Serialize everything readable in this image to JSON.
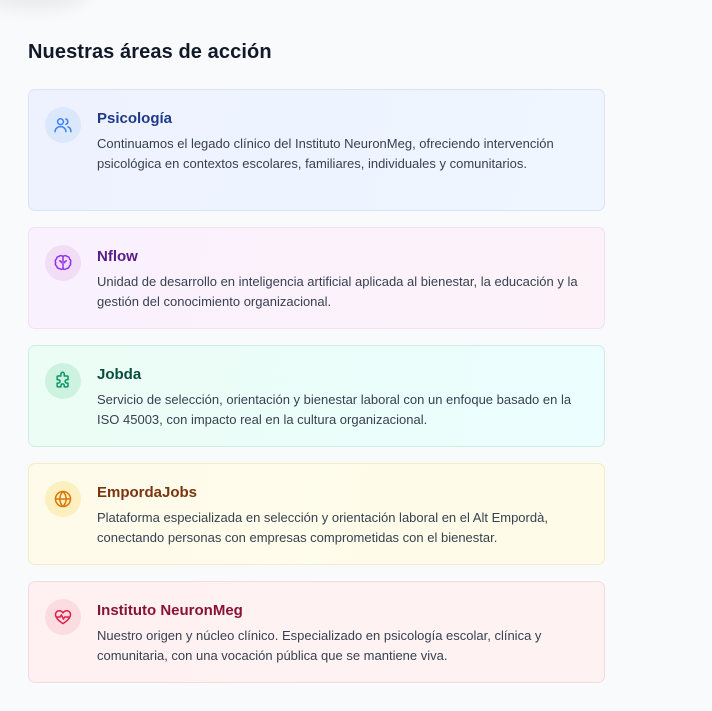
{
  "section": {
    "title": "Nuestras áreas de acción"
  },
  "cards": [
    {
      "title": "Psicología",
      "description": "Continuamos el legado clínico del Instituto NeuronMeg, ofreciendo intervención psicológica en contextos escolares, familiares, individuales y comunitarios.",
      "icon": "users-icon",
      "accent": "#1e3a8a"
    },
    {
      "title": "Nflow",
      "description": "Unidad de desarrollo en inteligencia artificial aplicada al bienestar, la educación y la gestión del conocimiento organizacional.",
      "icon": "brain-icon",
      "accent": "#581c87"
    },
    {
      "title": "Jobda",
      "description": "Servicio de selección, orientación y bienestar laboral con un enfoque basado en la ISO 45003, con impacto real en la cultura organizacional.",
      "icon": "puzzle-icon",
      "accent": "#064e3b"
    },
    {
      "title": "EmpordaJobs",
      "description": "Plataforma especializada en selección y orientación laboral en el Alt Empordà, conectando personas con empresas comprometidas con el bienestar.",
      "icon": "globe-icon",
      "accent": "#78350f"
    },
    {
      "title": "Instituto NeuronMeg",
      "description": "Nuestro origen y núcleo clínico. Especializado en psicología escolar, clínica y comunitaria, con una vocación pública que se mantiene viva.",
      "icon": "heart-pulse-icon",
      "accent": "#881337"
    }
  ]
}
